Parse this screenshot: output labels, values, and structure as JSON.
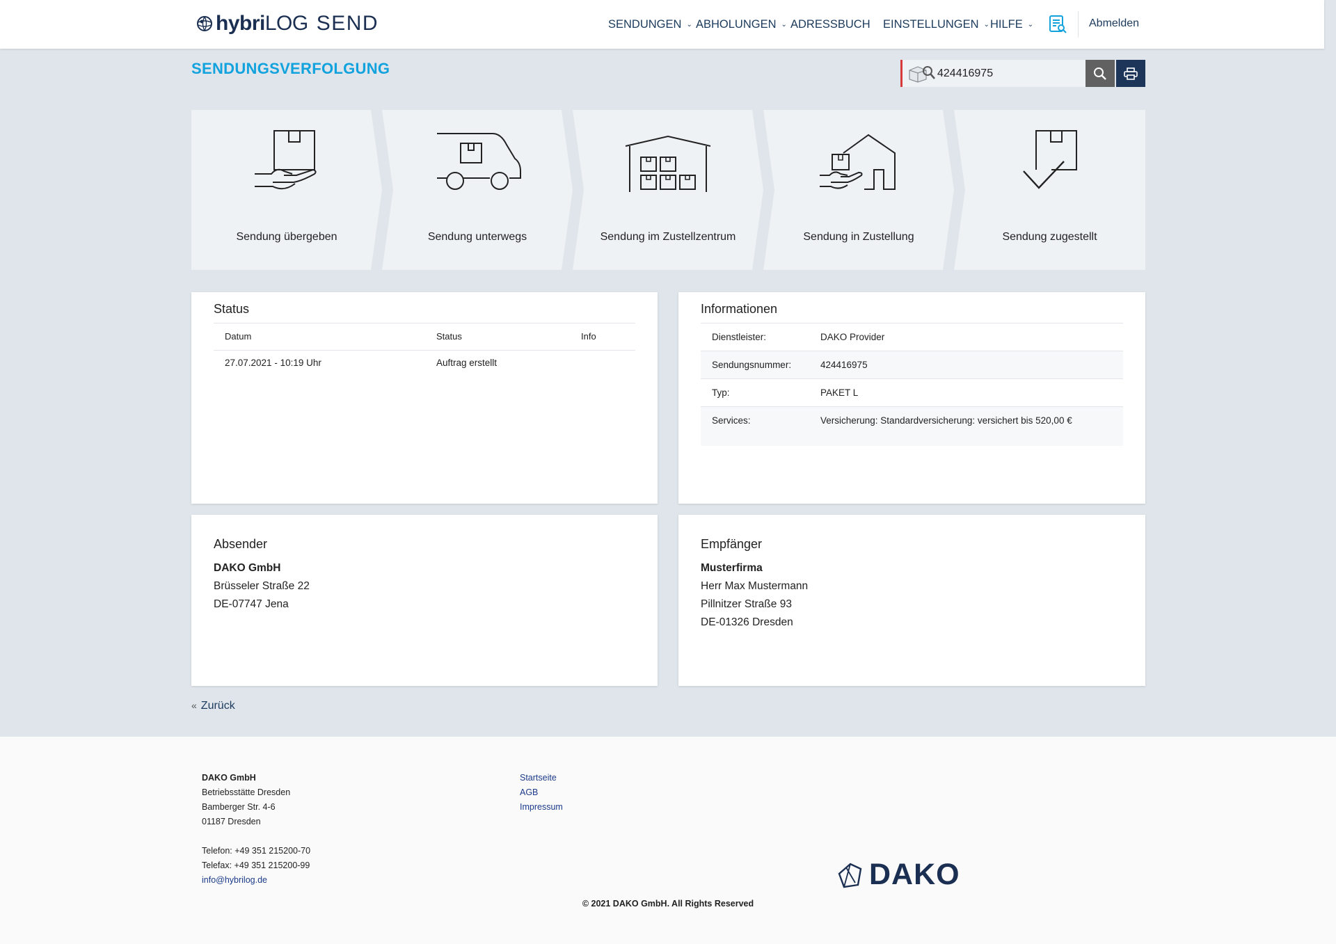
{
  "header": {
    "brand_bold": "hybri",
    "brand_light": "LOG",
    "brand_product": "SEND",
    "nav": [
      {
        "label": "SENDUNGEN",
        "dropdown": true
      },
      {
        "label": "ABHOLUNGEN",
        "dropdown": true
      },
      {
        "label": "ADRESSBUCH",
        "dropdown": false
      },
      {
        "label": "EINSTELLUNGEN",
        "dropdown": true
      },
      {
        "label": "HILFE",
        "dropdown": true
      }
    ],
    "tracking_icon": "document-search-icon",
    "logout": "Abmelden"
  },
  "tracking": {
    "title": "SENDUNGSVERFOLGUNG",
    "search_value": "424416975",
    "search_icon": "magnifier-icon",
    "print_icon": "printer-icon",
    "accent_color": "#12a2dd"
  },
  "steps": [
    {
      "label": "Sendung übergeben",
      "icon": "hand-package-icon"
    },
    {
      "label": "Sendung unterwegs",
      "icon": "delivery-van-icon"
    },
    {
      "label": "Sendung im Zustellzentrum",
      "icon": "warehouse-icon"
    },
    {
      "label": "Sendung in Zustellung",
      "icon": "house-delivery-icon"
    },
    {
      "label": "Sendung zugestellt",
      "icon": "package-check-icon"
    }
  ],
  "status": {
    "title": "Status",
    "columns": [
      "Datum",
      "Status",
      "Info"
    ],
    "rows": [
      {
        "date": "27.07.2021 - 10:19 Uhr",
        "status": "Auftrag erstellt",
        "info": ""
      }
    ]
  },
  "info": {
    "title": "Informationen",
    "rows": [
      {
        "label": "Dienstleister:",
        "value": "DAKO Provider"
      },
      {
        "label": "Sendungsnummer:",
        "value": "424416975"
      },
      {
        "label": "Typ:",
        "value": "PAKET L"
      },
      {
        "label": "Services:",
        "value": "Versicherung: Standardversicherung: versichert bis 520,00 €"
      }
    ]
  },
  "sender": {
    "title": "Absender",
    "name": "DAKO GmbH",
    "street": "Brüsseler Straße 22",
    "city": "DE-07747 Jena"
  },
  "recipient": {
    "title": "Empfänger",
    "name": "Musterfirma",
    "contact": "Herr Max Mustermann",
    "street": "Pillnitzer Straße 93",
    "city": "DE-01326 Dresden"
  },
  "back_label": "Zurück",
  "footer": {
    "company": "DAKO GmbH",
    "branch": "Betriebsstätte Dresden",
    "street": "Bamberger Str. 4-6",
    "city": "01187 Dresden",
    "phone": "Telefon: +49 351 215200-70",
    "fax": "Telefax: +49 351 215200-99",
    "email": "info@hybrilog.de",
    "links": [
      "Startseite",
      "AGB",
      "Impressum"
    ],
    "logo_text": "DAKO",
    "copyright": "© 2021 DAKO GmbH. All Rights Reserved"
  }
}
